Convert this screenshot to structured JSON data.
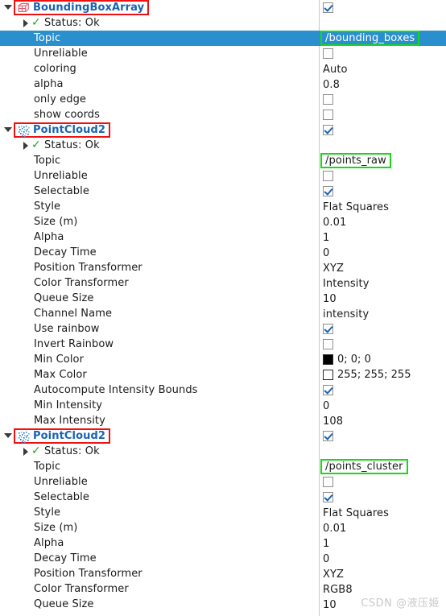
{
  "panel": {
    "kind": "rviz-displays-property-tree",
    "selected_row_label": "Topic",
    "colors": {
      "selection_blue": "#2a8fcd",
      "title_blue": "#1763b5",
      "annotation_red": "#ee1111",
      "annotation_green": "#18d818",
      "status_green": "#17a81a"
    }
  },
  "watermark": {
    "text": "CSDN @液压姬"
  },
  "displays": [
    {
      "title": "BoundingBoxArray",
      "icon": "bounding-box-array-icon",
      "enabled_label": "",
      "enabled": true,
      "annotated": true,
      "expanded": true,
      "status": {
        "label": "Status: Ok",
        "value": ""
      },
      "properties": [
        {
          "label": "Topic",
          "value": "/bounding_boxes",
          "type": "text",
          "selected": true,
          "annotated": true
        },
        {
          "label": "Unreliable",
          "value": "",
          "type": "checkbox",
          "checked": false
        },
        {
          "label": "coloring",
          "value": "Auto",
          "type": "text"
        },
        {
          "label": "alpha",
          "value": "0.8",
          "type": "text"
        },
        {
          "label": "only edge",
          "value": "",
          "type": "checkbox",
          "checked": false
        },
        {
          "label": "show coords",
          "value": "",
          "type": "checkbox",
          "checked": false
        }
      ]
    },
    {
      "title": "PointCloud2",
      "icon": "point-cloud-icon",
      "enabled": true,
      "annotated": true,
      "expanded": true,
      "status": {
        "label": "Status: Ok",
        "value": ""
      },
      "properties": [
        {
          "label": "Topic",
          "value": "/points_raw",
          "type": "text",
          "annotated": true
        },
        {
          "label": "Unreliable",
          "value": "",
          "type": "checkbox",
          "checked": false
        },
        {
          "label": "Selectable",
          "value": "",
          "type": "checkbox",
          "checked": true
        },
        {
          "label": "Style",
          "value": "Flat Squares",
          "type": "text"
        },
        {
          "label": "Size (m)",
          "value": "0.01",
          "type": "text"
        },
        {
          "label": "Alpha",
          "value": "1",
          "type": "text"
        },
        {
          "label": "Decay Time",
          "value": "0",
          "type": "text"
        },
        {
          "label": "Position Transformer",
          "value": "XYZ",
          "type": "text"
        },
        {
          "label": "Color Transformer",
          "value": "Intensity",
          "type": "text"
        },
        {
          "label": "Queue Size",
          "value": "10",
          "type": "text"
        },
        {
          "label": "Channel Name",
          "value": "intensity",
          "type": "text"
        },
        {
          "label": "Use rainbow",
          "value": "",
          "type": "checkbox",
          "checked": true
        },
        {
          "label": "Invert Rainbow",
          "value": "",
          "type": "checkbox",
          "checked": false
        },
        {
          "label": "Min Color",
          "value": "0; 0; 0",
          "type": "color",
          "swatch": "#000000"
        },
        {
          "label": "Max Color",
          "value": "255; 255; 255",
          "type": "color",
          "swatch": "#ffffff"
        },
        {
          "label": "Autocompute Intensity Bounds",
          "value": "",
          "type": "checkbox",
          "checked": true
        },
        {
          "label": "Min Intensity",
          "value": "0",
          "type": "text"
        },
        {
          "label": "Max Intensity",
          "value": "108",
          "type": "text"
        }
      ]
    },
    {
      "title": "PointCloud2",
      "icon": "point-cloud-icon",
      "enabled": true,
      "annotated": true,
      "expanded": true,
      "status": {
        "label": "Status: Ok",
        "value": ""
      },
      "properties": [
        {
          "label": "Topic",
          "value": "/points_cluster",
          "type": "text",
          "annotated": true
        },
        {
          "label": "Unreliable",
          "value": "",
          "type": "checkbox",
          "checked": false
        },
        {
          "label": "Selectable",
          "value": "",
          "type": "checkbox",
          "checked": true
        },
        {
          "label": "Style",
          "value": "Flat Squares",
          "type": "text"
        },
        {
          "label": "Size (m)",
          "value": "0.01",
          "type": "text"
        },
        {
          "label": "Alpha",
          "value": "1",
          "type": "text"
        },
        {
          "label": "Decay Time",
          "value": "0",
          "type": "text"
        },
        {
          "label": "Position Transformer",
          "value": "XYZ",
          "type": "text"
        },
        {
          "label": "Color Transformer",
          "value": "RGB8",
          "type": "text"
        },
        {
          "label": "Queue Size",
          "value": "10",
          "type": "text"
        }
      ]
    }
  ]
}
